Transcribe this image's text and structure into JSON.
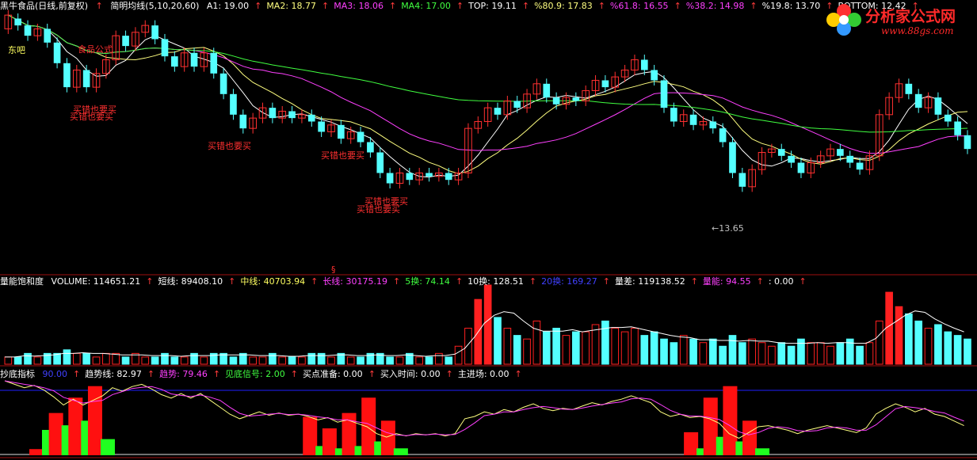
{
  "panel1": {
    "name": "黑牛食品(日线,前复权)",
    "indicator": "简明均线(5,10,20,60)",
    "items": [
      {
        "label": "A1:",
        "value": "19.00",
        "color": "#ffffff"
      },
      {
        "label": "MA2:",
        "value": "18.77",
        "color": "#ffff80"
      },
      {
        "label": "MA3:",
        "value": "18.06",
        "color": "#ff40ff"
      },
      {
        "label": "MA4:",
        "value": "17.00",
        "color": "#40ff40"
      },
      {
        "label": "TOP:",
        "value": "19.11",
        "color": "#ffffff"
      },
      {
        "label": "%80.9:",
        "value": "17.83",
        "color": "#ffff80"
      },
      {
        "label": "%61.8:",
        "value": "16.55",
        "color": "#ff40ff"
      },
      {
        "label": "%38.2:",
        "value": "14.98",
        "color": "#ff40ff"
      },
      {
        "label": "%19.8:",
        "value": "13.70",
        "color": "#ffffff"
      },
      {
        "label": "BOTTOM:",
        "value": "12.42",
        "color": "#ffffff"
      }
    ]
  },
  "panel2": {
    "name": "量能饱和度",
    "items": [
      {
        "label": "VOLUME:",
        "value": "114651.21",
        "color": "#ffffff"
      },
      {
        "label": "短线:",
        "value": "89408.10",
        "color": "#ffffff"
      },
      {
        "label": "中线:",
        "value": "40703.94",
        "color": "#ffff60"
      },
      {
        "label": "长线:",
        "value": "30175.19",
        "color": "#ff40ff"
      },
      {
        "label": "5换:",
        "value": "74.14",
        "color": "#40ff40"
      },
      {
        "label": "10换:",
        "value": "128.51",
        "color": "#ffffff"
      },
      {
        "label": "20换:",
        "value": "169.27",
        "color": "#4040ff"
      },
      {
        "label": "量差:",
        "value": "119138.52",
        "color": "#ffffff"
      },
      {
        "label": "量能:",
        "value": "94.55",
        "color": "#ff40ff"
      },
      {
        "label": ":",
        "value": "0.00",
        "color": "#ffffff"
      }
    ]
  },
  "panel3": {
    "name": "抄底指标",
    "items": [
      {
        "label": "",
        "value": "90.00",
        "color": "#4040ff"
      },
      {
        "label": "趋势线:",
        "value": "82.97",
        "color": "#ffffff"
      },
      {
        "label": "趋势:",
        "value": "79.46",
        "color": "#ff40ff"
      },
      {
        "label": "见底信号:",
        "value": "2.00",
        "color": "#40ff40"
      },
      {
        "label": "买点准备:",
        "value": "0.00",
        "color": "#ffffff"
      },
      {
        "label": "买入时间:",
        "value": "0.00",
        "color": "#ffffff"
      },
      {
        "label": "主进场:",
        "value": "0.00",
        "color": "#ffffff"
      }
    ]
  },
  "logo": {
    "brand": "分析家公式网",
    "url": "www.88gs.com"
  },
  "annotations": {
    "buy_signal": "买错也要买",
    "first_label": "东吧",
    "second_label": "食品公式",
    "low_price": "←13.65",
    "marker": "§"
  },
  "chart_data": {
    "type": "candlestick",
    "price_range": [
      12.42,
      19.11
    ],
    "candles": [
      {
        "o": 18.5,
        "c": 18.9
      },
      {
        "o": 18.8,
        "c": 18.6
      },
      {
        "o": 18.6,
        "c": 18.3
      },
      {
        "o": 18.3,
        "c": 18.5
      },
      {
        "o": 18.5,
        "c": 18.1
      },
      {
        "o": 18.1,
        "c": 17.5
      },
      {
        "o": 17.5,
        "c": 16.8
      },
      {
        "o": 16.8,
        "c": 17.3
      },
      {
        "o": 17.3,
        "c": 16.8
      },
      {
        "o": 16.8,
        "c": 17.2
      },
      {
        "o": 17.2,
        "c": 17.6
      },
      {
        "o": 17.6,
        "c": 18.3
      },
      {
        "o": 18.3,
        "c": 18.0
      },
      {
        "o": 18.0,
        "c": 18.4
      },
      {
        "o": 18.4,
        "c": 18.6
      },
      {
        "o": 18.6,
        "c": 18.2
      },
      {
        "o": 18.2,
        "c": 17.7
      },
      {
        "o": 17.7,
        "c": 17.4
      },
      {
        "o": 17.4,
        "c": 17.8
      },
      {
        "o": 17.8,
        "c": 17.4
      },
      {
        "o": 17.4,
        "c": 17.8
      },
      {
        "o": 17.8,
        "c": 17.2
      },
      {
        "o": 17.2,
        "c": 16.6
      },
      {
        "o": 16.6,
        "c": 16.0
      },
      {
        "o": 16.0,
        "c": 15.6
      },
      {
        "o": 15.6,
        "c": 15.9
      },
      {
        "o": 15.9,
        "c": 16.2
      },
      {
        "o": 16.2,
        "c": 15.9
      },
      {
        "o": 15.9,
        "c": 16.1
      },
      {
        "o": 16.1,
        "c": 15.9
      },
      {
        "o": 15.9,
        "c": 16.0
      },
      {
        "o": 16.0,
        "c": 15.8
      },
      {
        "o": 15.8,
        "c": 15.5
      },
      {
        "o": 15.5,
        "c": 15.7
      },
      {
        "o": 15.7,
        "c": 15.3
      },
      {
        "o": 15.3,
        "c": 15.5
      },
      {
        "o": 15.5,
        "c": 15.2
      },
      {
        "o": 15.2,
        "c": 14.9
      },
      {
        "o": 14.9,
        "c": 14.3
      },
      {
        "o": 14.3,
        "c": 14.0
      },
      {
        "o": 14.0,
        "c": 14.3
      },
      {
        "o": 14.3,
        "c": 14.1
      },
      {
        "o": 14.1,
        "c": 14.3
      },
      {
        "o": 14.3,
        "c": 14.2
      },
      {
        "o": 14.2,
        "c": 14.3
      },
      {
        "o": 14.3,
        "c": 14.1
      },
      {
        "o": 14.1,
        "c": 14.3
      },
      {
        "o": 14.3,
        "c": 15.6
      },
      {
        "o": 15.6,
        "c": 15.8
      },
      {
        "o": 15.8,
        "c": 16.2
      },
      {
        "o": 16.2,
        "c": 16.0
      },
      {
        "o": 16.0,
        "c": 16.4
      },
      {
        "o": 16.4,
        "c": 16.2
      },
      {
        "o": 16.2,
        "c": 16.6
      },
      {
        "o": 16.6,
        "c": 16.9
      },
      {
        "o": 16.9,
        "c": 16.5
      },
      {
        "o": 16.5,
        "c": 16.3
      },
      {
        "o": 16.3,
        "c": 16.5
      },
      {
        "o": 16.5,
        "c": 16.4
      },
      {
        "o": 16.4,
        "c": 16.7
      },
      {
        "o": 16.7,
        "c": 17.0
      },
      {
        "o": 17.0,
        "c": 16.8
      },
      {
        "o": 16.8,
        "c": 17.1
      },
      {
        "o": 17.1,
        "c": 17.3
      },
      {
        "o": 17.3,
        "c": 17.6
      },
      {
        "o": 17.6,
        "c": 17.3
      },
      {
        "o": 17.3,
        "c": 17.0
      },
      {
        "o": 17.0,
        "c": 16.2
      },
      {
        "o": 16.2,
        "c": 15.8
      },
      {
        "o": 15.8,
        "c": 16.0
      },
      {
        "o": 16.0,
        "c": 15.7
      },
      {
        "o": 15.7,
        "c": 15.8
      },
      {
        "o": 15.8,
        "c": 15.6
      },
      {
        "o": 15.6,
        "c": 15.2
      },
      {
        "o": 15.2,
        "c": 14.3
      },
      {
        "o": 14.3,
        "c": 13.9
      },
      {
        "o": 13.9,
        "c": 14.4
      },
      {
        "o": 14.4,
        "c": 14.9
      },
      {
        "o": 14.9,
        "c": 15.0
      },
      {
        "o": 15.0,
        "c": 14.8
      },
      {
        "o": 14.8,
        "c": 14.6
      },
      {
        "o": 14.6,
        "c": 14.3
      },
      {
        "o": 14.3,
        "c": 14.6
      },
      {
        "o": 14.6,
        "c": 14.8
      },
      {
        "o": 14.8,
        "c": 15.0
      },
      {
        "o": 15.0,
        "c": 14.8
      },
      {
        "o": 14.8,
        "c": 14.6
      },
      {
        "o": 14.6,
        "c": 14.4
      },
      {
        "o": 14.4,
        "c": 14.8
      },
      {
        "o": 14.8,
        "c": 16.0
      },
      {
        "o": 16.0,
        "c": 16.5
      },
      {
        "o": 16.5,
        "c": 16.9
      },
      {
        "o": 16.9,
        "c": 16.6
      },
      {
        "o": 16.6,
        "c": 16.2
      },
      {
        "o": 16.2,
        "c": 16.5
      },
      {
        "o": 16.5,
        "c": 16.0
      },
      {
        "o": 16.0,
        "c": 15.8
      },
      {
        "o": 15.8,
        "c": 15.4
      },
      {
        "o": 15.4,
        "c": 15.0
      }
    ],
    "volume": [
      0.2,
      0.2,
      0.3,
      0.2,
      0.3,
      0.3,
      0.4,
      0.3,
      0.3,
      0.2,
      0.3,
      0.3,
      0.2,
      0.3,
      0.2,
      0.2,
      0.3,
      0.2,
      0.2,
      0.3,
      0.2,
      0.3,
      0.3,
      0.2,
      0.3,
      0.2,
      0.2,
      0.3,
      0.2,
      0.2,
      0.2,
      0.3,
      0.3,
      0.2,
      0.3,
      0.2,
      0.2,
      0.3,
      0.3,
      0.2,
      0.2,
      0.3,
      0.2,
      0.2,
      0.3,
      0.2,
      0.5,
      1.0,
      1.8,
      2.2,
      1.3,
      1.0,
      0.8,
      0.7,
      1.2,
      0.9,
      1.0,
      0.8,
      0.9,
      0.9,
      1.1,
      1.2,
      1.0,
      0.9,
      1.0,
      0.8,
      0.9,
      0.7,
      0.6,
      0.8,
      0.7,
      0.6,
      0.7,
      0.5,
      0.8,
      0.6,
      0.7,
      0.6,
      0.5,
      0.6,
      0.5,
      0.7,
      0.6,
      0.6,
      0.5,
      0.6,
      0.7,
      0.5,
      0.6,
      1.2,
      2.0,
      1.6,
      1.4,
      1.2,
      1.0,
      1.1,
      0.9,
      0.8,
      0.7
    ],
    "bottom_bars": [
      {
        "x": 0.03,
        "red": 0.08,
        "green": 0.55
      },
      {
        "x": 0.05,
        "red": 0.55,
        "green": 0.65
      },
      {
        "x": 0.07,
        "red": 0.75,
        "green": 0.75
      },
      {
        "x": 0.09,
        "red": 0.9,
        "green": 0.35
      },
      {
        "x": 0.31,
        "red": 0.5,
        "green": 0.2
      },
      {
        "x": 0.33,
        "red": 0.35,
        "green": 0.15
      },
      {
        "x": 0.35,
        "red": 0.55,
        "green": 0.2
      },
      {
        "x": 0.37,
        "red": 0.75,
        "green": 0.3
      },
      {
        "x": 0.39,
        "red": 0.45,
        "green": 0.15
      },
      {
        "x": 0.7,
        "red": 0.3,
        "green": 0.15
      },
      {
        "x": 0.72,
        "red": 0.75,
        "green": 0.4
      },
      {
        "x": 0.74,
        "red": 0.9,
        "green": 0.3
      },
      {
        "x": 0.76,
        "red": 0.45,
        "green": 0.15
      }
    ]
  }
}
